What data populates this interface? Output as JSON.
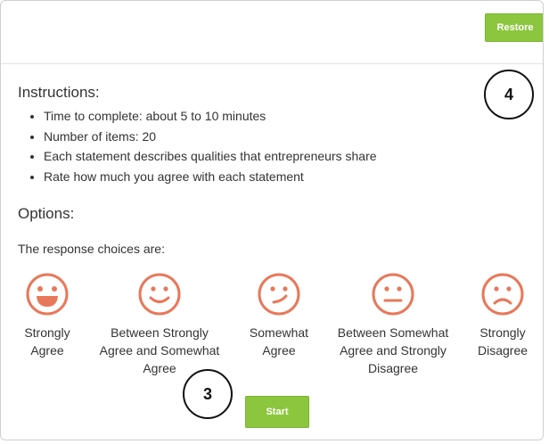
{
  "header": {
    "restore_label": "Restore"
  },
  "instructions": {
    "title": "Instructions:",
    "items": [
      "Time to complete: about 5 to 10 minutes",
      "Number of items: 20",
      "Each statement describes qualities that entrepreneurs share",
      "Rate how much you agree with each statement"
    ]
  },
  "options": {
    "title": "Options:",
    "intro": "The response choices are:",
    "choices": [
      {
        "label_lines": [
          "Strongly",
          "Agree"
        ],
        "icon": "big-smile-icon"
      },
      {
        "label_lines": [
          "Between Strongly",
          "Agree and Somewhat",
          "Agree"
        ],
        "icon": "smile-icon"
      },
      {
        "label_lines": [
          "Somewhat",
          "Agree"
        ],
        "icon": "wink-smile-icon"
      },
      {
        "label_lines": [
          "Between Somewhat",
          "Agree and Strongly",
          "Disagree"
        ],
        "icon": "neutral-face-icon"
      },
      {
        "label_lines": [
          "Strongly",
          "Disagree"
        ],
        "icon": "sad-face-icon"
      }
    ],
    "icon_color": "#e8785a"
  },
  "start_label": "Start",
  "callouts": {
    "a": "4",
    "b": "3"
  },
  "colors": {
    "accent": "#8cc63f"
  }
}
